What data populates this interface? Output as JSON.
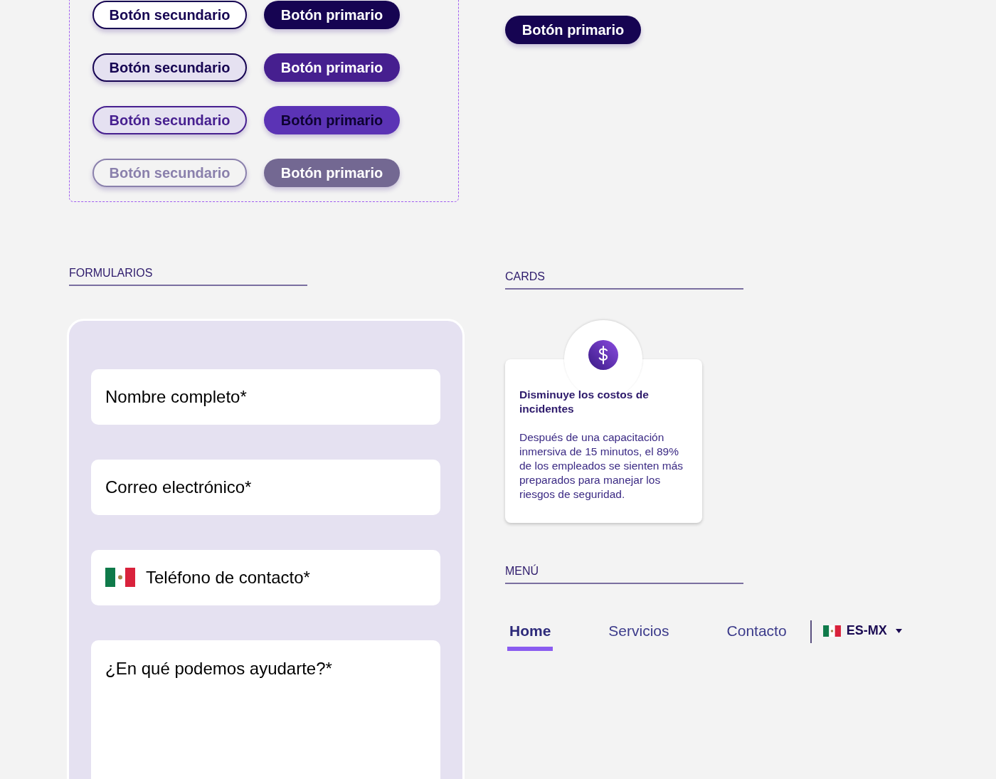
{
  "button_grid": {
    "rows": [
      {
        "kind": "default",
        "secondary": "Botón secundario",
        "primary": "Botón primario"
      },
      {
        "kind": "hover",
        "secondary": "Botón secundario",
        "primary": "Botón primario"
      },
      {
        "kind": "pressed",
        "secondary": "Botón secundario",
        "primary": "Botón primario"
      },
      {
        "kind": "disabled",
        "secondary": "Botón secundario",
        "primary": "Botón primario"
      }
    ]
  },
  "right_button": {
    "label": "Botón primario",
    "kind": "default"
  },
  "forms": {
    "heading": "FORMULARIOS",
    "fields": [
      {
        "kind": "text",
        "placeholder": "Nombre completo*"
      },
      {
        "kind": "text",
        "placeholder": "Correo electrónico*"
      },
      {
        "kind": "phone",
        "placeholder": "Teléfono de contacto*"
      },
      {
        "kind": "textarea",
        "placeholder": "¿En qué podemos ayudarte?*"
      }
    ]
  },
  "cards": {
    "heading": "CARDS",
    "card": {
      "title": "Disminuye los costos de incidentes",
      "body": "Después de una capacitación inmersiva de 15 minutos, el 89% de los empleados se sienten más preparados para manejar los riesgos de seguridad."
    }
  },
  "menu": {
    "heading": "MENÚ",
    "items": [
      {
        "label": "Home",
        "selected": true
      },
      {
        "label": "Servicios",
        "selected": false
      },
      {
        "label": "Contacto",
        "selected": false
      }
    ],
    "language": {
      "label": "ES-MX"
    }
  }
}
